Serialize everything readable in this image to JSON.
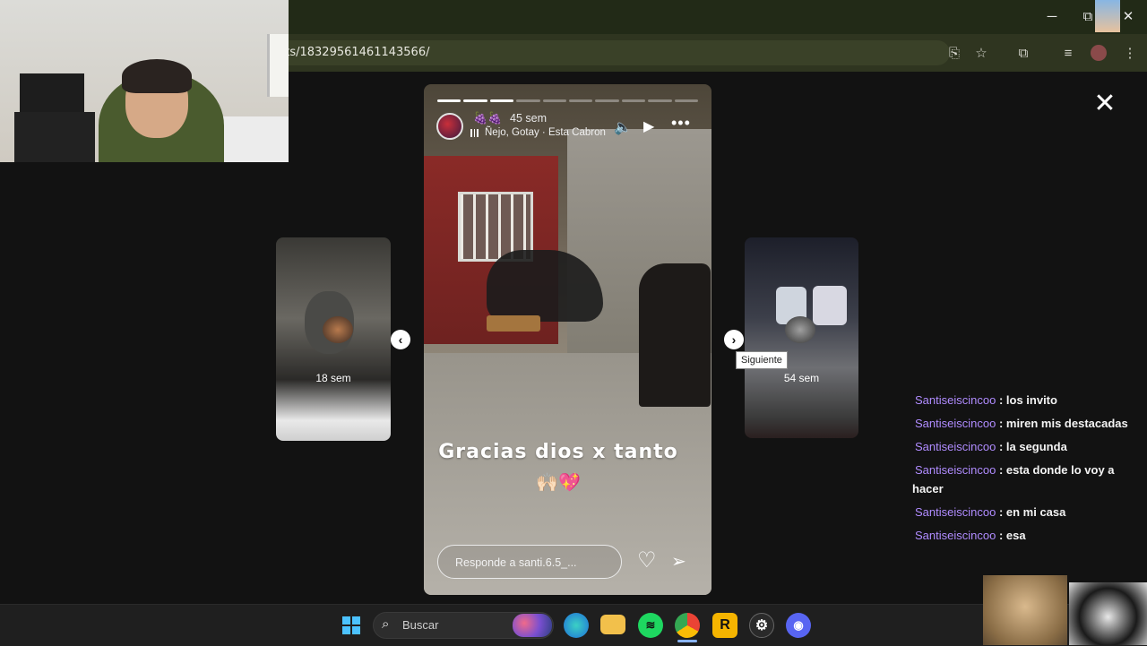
{
  "browser": {
    "url": "nts/18329561461143566/",
    "window_controls": {
      "minimize": "─",
      "restore": "⧉",
      "close": "✕"
    },
    "toolbar_icons": [
      "install-app-icon",
      "bookmark-star-icon",
      "extensions-icon",
      "reading-list-icon",
      "profile-icon",
      "menu-icon"
    ]
  },
  "viewer": {
    "close_label": "✕",
    "story": {
      "reaction_emojis": "🍇🍇",
      "time_ago": "45 sem",
      "song": "Ñejo, Gotay · Esta Cabron",
      "caption": "Gracias dios x tanto",
      "caption_emoji": "🙌🏻💖",
      "reply_placeholder": "Responde a santi.6.5_...",
      "progress_segments": 10,
      "progress_done": 3
    },
    "prev_story": {
      "label": "18 sem"
    },
    "next_story": {
      "label": "54 sem"
    },
    "next_tooltip": "Siguiente"
  },
  "chat": [
    {
      "user": "Santiseiscincoo",
      "msg": "los invito"
    },
    {
      "user": "Santiseiscincoo",
      "msg": "miren mis destacadas"
    },
    {
      "user": "Santiseiscincoo",
      "msg": "la segunda"
    },
    {
      "user": "Santiseiscincoo",
      "msg": "esta donde lo voy a hacer"
    },
    {
      "user": "Santiseiscincoo",
      "msg": "en mi casa"
    },
    {
      "user": "Santiseiscincoo",
      "msg": "esa"
    }
  ],
  "taskbar": {
    "search_placeholder": "Buscar",
    "apps": [
      "windows-start-icon",
      "edge-icon",
      "file-explorer-icon",
      "spotify-icon",
      "chrome-icon",
      "rockstar-icon",
      "steam-icon",
      "discord-icon"
    ]
  },
  "colors": {
    "chat_user": "#b08cff",
    "chrome_toolbar": "#2f3520",
    "taskbar": "#1f1f1f"
  }
}
